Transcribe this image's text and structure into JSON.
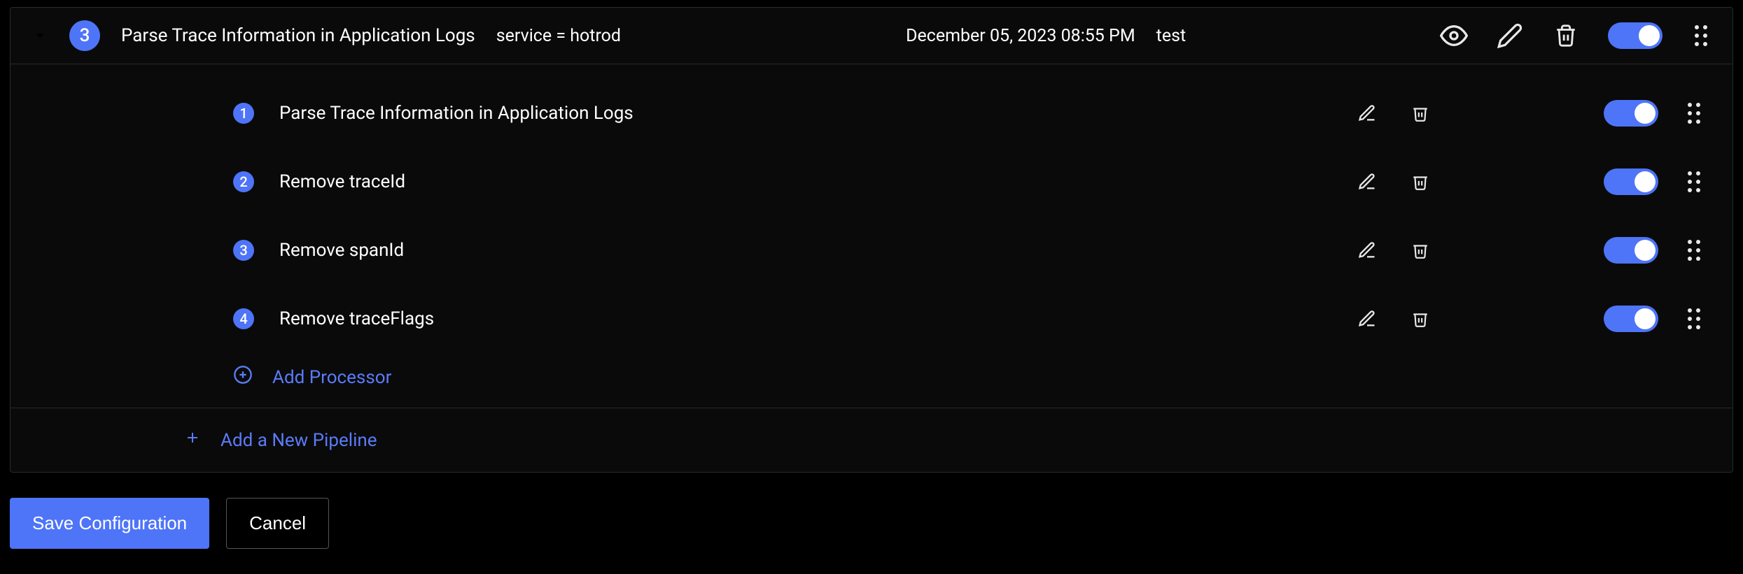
{
  "pipeline": {
    "index": "3",
    "name": "Parse Trace Information in Application Logs",
    "filter": "service = hotrod",
    "edited_on": "December 05, 2023 08:55 PM",
    "edited_by": "test"
  },
  "processors": [
    {
      "index": "1",
      "name": "Parse Trace Information in Application Logs"
    },
    {
      "index": "2",
      "name": "Remove traceId"
    },
    {
      "index": "3",
      "name": "Remove spanId"
    },
    {
      "index": "4",
      "name": "Remove traceFlags"
    }
  ],
  "actions": {
    "add_processor": "Add Processor",
    "add_pipeline": "Add a New Pipeline",
    "save": "Save Configuration",
    "cancel": "Cancel"
  }
}
